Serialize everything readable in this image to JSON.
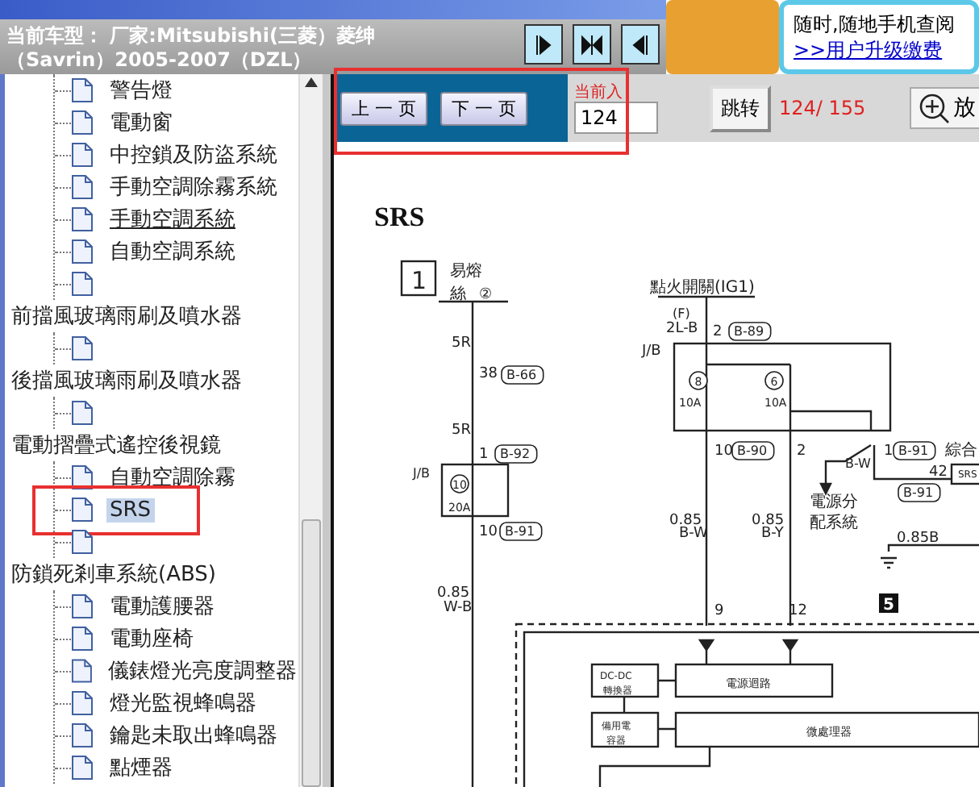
{
  "header": {
    "vehicle_line_1": "当前车型： 厂家:Mitsubishi(三菱）菱绅",
    "vehicle_line_2": "（Savrin）2005-2007（DZL）"
  },
  "banner": {
    "text": "随时,随地手机查阅",
    "link": ">>用户升级缴费"
  },
  "tree": [
    {
      "children": [
        {
          "label": "警告燈",
          "selected": false,
          "hovered": false
        },
        {
          "label": "電動窗",
          "selected": false,
          "hovered": false
        },
        {
          "label": "中控鎖及防盜系統",
          "selected": false,
          "hovered": false
        },
        {
          "label": "手動空調除霧系統",
          "selected": false,
          "hovered": false
        },
        {
          "label": "手動空調系統",
          "selected": false,
          "hovered": true
        },
        {
          "label": "自動空調系統",
          "selected": false,
          "hovered": false
        },
        {
          "selected": false
        }
      ]
    },
    {
      "label": "前擋風玻璃雨刷及噴水器",
      "children": [
        {
          "selected": false
        }
      ]
    },
    {
      "label": "後擋風玻璃雨刷及噴水器",
      "children": [
        {
          "selected": false
        }
      ]
    },
    {
      "label": "電動摺疊式遙控後視鏡",
      "children": [
        {
          "label": "自動空調除霧",
          "selected": false,
          "hovered": false
        },
        {
          "label": "SRS",
          "selected": true,
          "hovered": false
        },
        {
          "selected": false
        }
      ]
    },
    {
      "label": "防鎖死剎車系統(ABS)",
      "children": [
        {
          "label": "電動護腰器",
          "selected": false,
          "hovered": false
        },
        {
          "label": "電動座椅",
          "selected": false,
          "hovered": false
        },
        {
          "label": "儀錶燈光亮度調整器",
          "selected": false,
          "hovered": false
        },
        {
          "label": "燈光監視蜂鳴器",
          "selected": false,
          "hovered": false
        },
        {
          "label": "鑰匙未取出蜂鳴器",
          "selected": false,
          "hovered": false
        },
        {
          "label": "點煙器",
          "selected": false,
          "hovered": false
        }
      ]
    }
  ],
  "toolbar": {
    "prev": "上 一 页",
    "next": "下 一 页",
    "page_label": "当前入",
    "page_value": "124",
    "jump": "跳转",
    "page_count": "124/ 155",
    "zoom": "放"
  },
  "diagram": {
    "title": "SRS",
    "labels": [
      "1",
      "易熔",
      "絲",
      "②",
      "5R",
      "38",
      "B-66",
      "5R",
      "1",
      "B-92",
      "J/B",
      "10",
      "20A",
      "10",
      "B-91",
      "0.85",
      "W-B",
      "點火開關(IG1)",
      "(F)",
      "2L-B",
      "2",
      "B-89",
      "J/B",
      "8",
      "10A",
      "6",
      "10A",
      "10",
      "B-90",
      "2",
      "1",
      "B-91",
      "綜合",
      "B-W",
      "42",
      "SRS",
      "B-91",
      "0.85",
      "B-W",
      "0.85",
      "B-Y",
      "電源分",
      "配系統",
      "0.85B",
      "5",
      "9",
      "12",
      "DC-DC",
      "轉換器",
      "電源迴路",
      "備用電",
      "容器",
      "微處理器"
    ]
  }
}
